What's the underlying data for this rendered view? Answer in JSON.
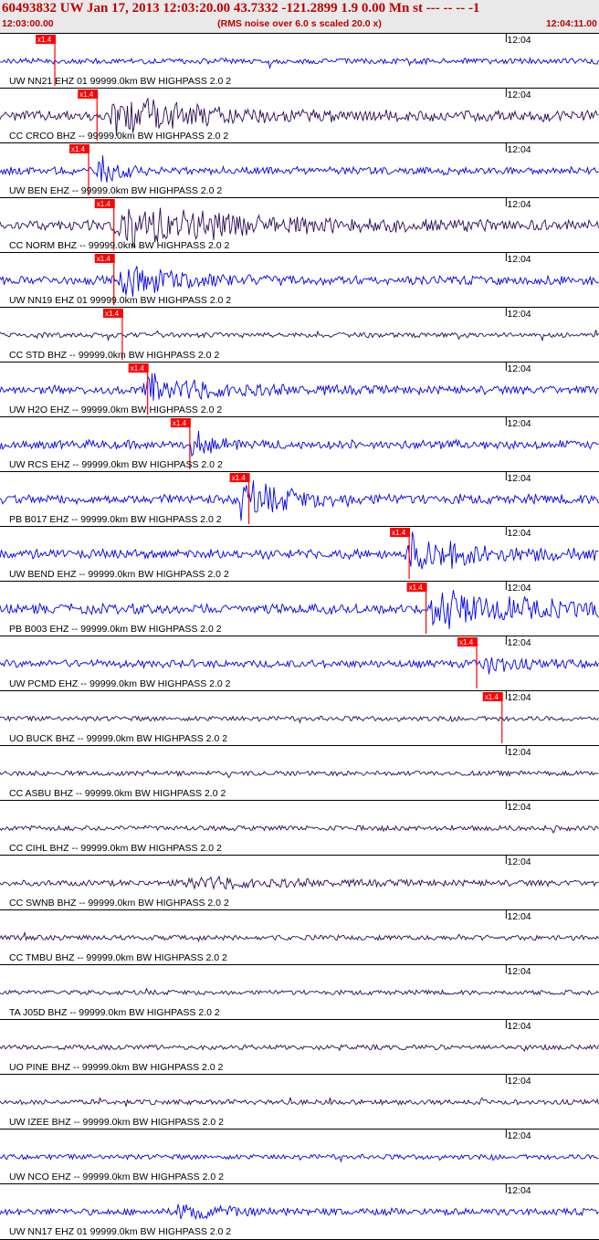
{
  "header": {
    "title": "60493832 UW Jan 17, 2013 12:03:20.00   43.7332 -121.2899  1.9 0.00 Mn st --- -- --   -1",
    "start_time": "12:03:00.00",
    "note": "(RMS noise over 6.0 s scaled 20.0 x)",
    "end_time": "12:04:11.00"
  },
  "colors": {
    "header_bg": "#e9e9e9",
    "header_text": "#c00000",
    "pick_marker": "#ff0000",
    "trace_blue": "#0000ee",
    "trace_dark": "#2a0a55",
    "grid": "#000000"
  },
  "chart_data": {
    "type": "line",
    "title": "60493832 UW Jan 17, 2013 12:03:20.00",
    "time_start": "12:03:00.00",
    "time_end": "12:04:11.00",
    "xlim_seconds": [
      0,
      71
    ],
    "minute_tick": {
      "label": "12:04",
      "time_s": 60
    },
    "pick_label": "x1.4",
    "traces": [
      {
        "label": "UW NN21 EHZ 01 99999.0km BW  HIGHPASS  2.0  2",
        "color": "blue",
        "pick": 6.5,
        "arrival": null,
        "amp": 0.25,
        "decay": 0
      },
      {
        "label": "CC CRCO BHZ -- 99999.0km BW  HIGHPASS  2.0  2",
        "color": "dark",
        "pick": 11.5,
        "arrival": 13,
        "amp": 1.0,
        "decay": 10
      },
      {
        "label": "UW BEN EHZ -- 99999.0km BW  HIGHPASS  2.0  2",
        "color": "blue",
        "pick": 10.5,
        "arrival": 11.5,
        "amp": 0.6,
        "decay": 3
      },
      {
        "label": "CC NORM BHZ -- 99999.0km BW  HIGHPASS  2.0  2",
        "color": "dark",
        "pick": 13.5,
        "arrival": 13.5,
        "amp": 1.0,
        "decay": 14
      },
      {
        "label": "UW NN19 EHZ 01 99999.0km BW  HIGHPASS  2.0  2",
        "color": "blue",
        "pick": 13.5,
        "arrival": 14,
        "amp": 0.8,
        "decay": 6
      },
      {
        "label": "CC STD BHZ -- 99999.0km BW  HIGHPASS  2.0  2",
        "color": "dark",
        "pick": 14.5,
        "arrival": null,
        "amp": 0.15,
        "decay": 0
      },
      {
        "label": "UW H2O EHZ -- 99999.0km BW  HIGHPASS  2.0  2",
        "color": "blue",
        "pick": 17.5,
        "arrival": 17,
        "amp": 0.7,
        "decay": 8
      },
      {
        "label": "UW RCS EHZ -- 99999.0km BW  HIGHPASS  2.0  2",
        "color": "blue",
        "pick": 22.5,
        "arrival": 22.5,
        "amp": 0.8,
        "decay": 2
      },
      {
        "label": "PB B017 EHZ -- 99999.0km BW  HIGHPASS  2.0  2",
        "color": "blue",
        "pick": 29.5,
        "arrival": 28.5,
        "amp": 0.9,
        "decay": 6
      },
      {
        "label": "UW BEND EHZ -- 99999.0km BW  HIGHPASS  2.0  2",
        "color": "blue",
        "pick": 48.5,
        "arrival": 48,
        "amp": 0.9,
        "decay": 8
      },
      {
        "label": "PB B003 EHZ -- 99999.0km BW  HIGHPASS  2.0  2",
        "color": "blue",
        "pick": 50.5,
        "arrival": 51,
        "amp": 1.0,
        "decay": 10
      },
      {
        "label": "UW PCMD EHZ -- 99999.0km BW  HIGHPASS  2.0  2",
        "color": "blue",
        "pick": 56.5,
        "arrival": 57,
        "amp": 0.6,
        "decay": 3
      },
      {
        "label": "UO BUCK BHZ -- 99999.0km BW  HIGHPASS  2.0  2",
        "color": "dark",
        "pick": 59.5,
        "arrival": null,
        "amp": 0.12,
        "decay": 0
      },
      {
        "label": "CC ASBU BHZ -- 99999.0km BW  HIGHPASS  2.0  2",
        "color": "dark",
        "pick": null,
        "arrival": null,
        "amp": 0.12,
        "decay": 0
      },
      {
        "label": "CC CIHL BHZ -- 99999.0km BW  HIGHPASS  2.0  2",
        "color": "dark",
        "pick": null,
        "arrival": null,
        "amp": 0.15,
        "decay": 0
      },
      {
        "label": "CC SWNB BHZ -- 99999.0km BW  HIGHPASS  2.0  2",
        "color": "dark",
        "pick": null,
        "arrival": 22,
        "amp": 0.3,
        "decay": 10
      },
      {
        "label": "CC TMBU BHZ -- 99999.0km BW  HIGHPASS  2.0  2",
        "color": "dark",
        "pick": null,
        "arrival": null,
        "amp": 0.15,
        "decay": 0
      },
      {
        "label": "TA J05D BHZ -- 99999.0km BW  HIGHPASS  2.0  2",
        "color": "dark",
        "pick": null,
        "arrival": null,
        "amp": 0.1,
        "decay": 0
      },
      {
        "label": "UO PINE BHZ -- 99999.0km BW  HIGHPASS  2.0  2",
        "color": "dark",
        "pick": null,
        "arrival": null,
        "amp": 0.12,
        "decay": 0
      },
      {
        "label": "UW IZEE BHZ -- 99999.0km BW  HIGHPASS  2.0  2",
        "color": "dark",
        "pick": null,
        "arrival": null,
        "amp": 0.15,
        "decay": 0
      },
      {
        "label": "UW NCO EHZ -- 99999.0km BW  HIGHPASS  2.0  2",
        "color": "blue",
        "pick": null,
        "arrival": null,
        "amp": 0.15,
        "decay": 0
      },
      {
        "label": "UW NN17 EHZ 01 99999.0km BW  HIGHPASS  2.0  2",
        "color": "blue",
        "pick": null,
        "arrival": 21,
        "amp": 0.45,
        "decay": 5
      }
    ]
  }
}
